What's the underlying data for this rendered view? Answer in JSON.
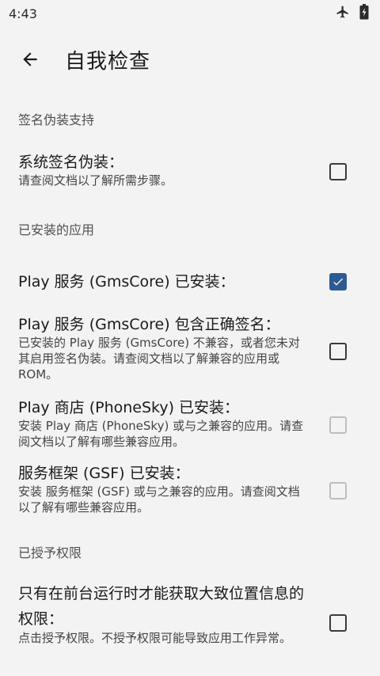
{
  "status_bar": {
    "time": "4:43",
    "icons": [
      "airplane-icon",
      "battery-icon"
    ]
  },
  "header": {
    "title": "自我检查"
  },
  "sections": {
    "signature": {
      "title": "签名伪装支持",
      "items": [
        {
          "title": "系统签名伪装：",
          "summary": "请查阅文档以了解所需步骤。",
          "checked": false,
          "enabled": true
        }
      ]
    },
    "installed": {
      "title": "已安装的应用",
      "items": [
        {
          "title": "Play 服务 (GmsCore) 已安装：",
          "summary": "",
          "checked": true,
          "enabled": true
        },
        {
          "title": "Play 服务 (GmsCore) 包含正确签名：",
          "summary": "已安装的 Play 服务 (GmsCore) 不兼容，或者您未对其启用签名伪装。请查阅文档以了解兼容的应用或 ROM。",
          "checked": false,
          "enabled": true
        },
        {
          "title": "Play 商店 (PhoneSky) 已安装：",
          "summary": "安装 Play 商店 (PhoneSky) 或与之兼容的应用。请查阅文档以了解有哪些兼容应用。",
          "checked": false,
          "enabled": false
        },
        {
          "title": "服务框架 (GSF) 已安装：",
          "summary": "安装 服务框架 (GSF) 或与之兼容的应用。请查阅文档以了解有哪些兼容应用。",
          "checked": false,
          "enabled": false
        }
      ]
    },
    "permissions": {
      "title": "已授予权限",
      "items": [
        {
          "title": "只有在前台运行时才能获取大致位置信息的权限：",
          "summary": "点击授予权限。不授予权限可能导致应用工作异常。",
          "checked": false,
          "enabled": true
        }
      ]
    }
  },
  "colors": {
    "background": "#f3f3f3",
    "accent": "#2d5a92"
  }
}
